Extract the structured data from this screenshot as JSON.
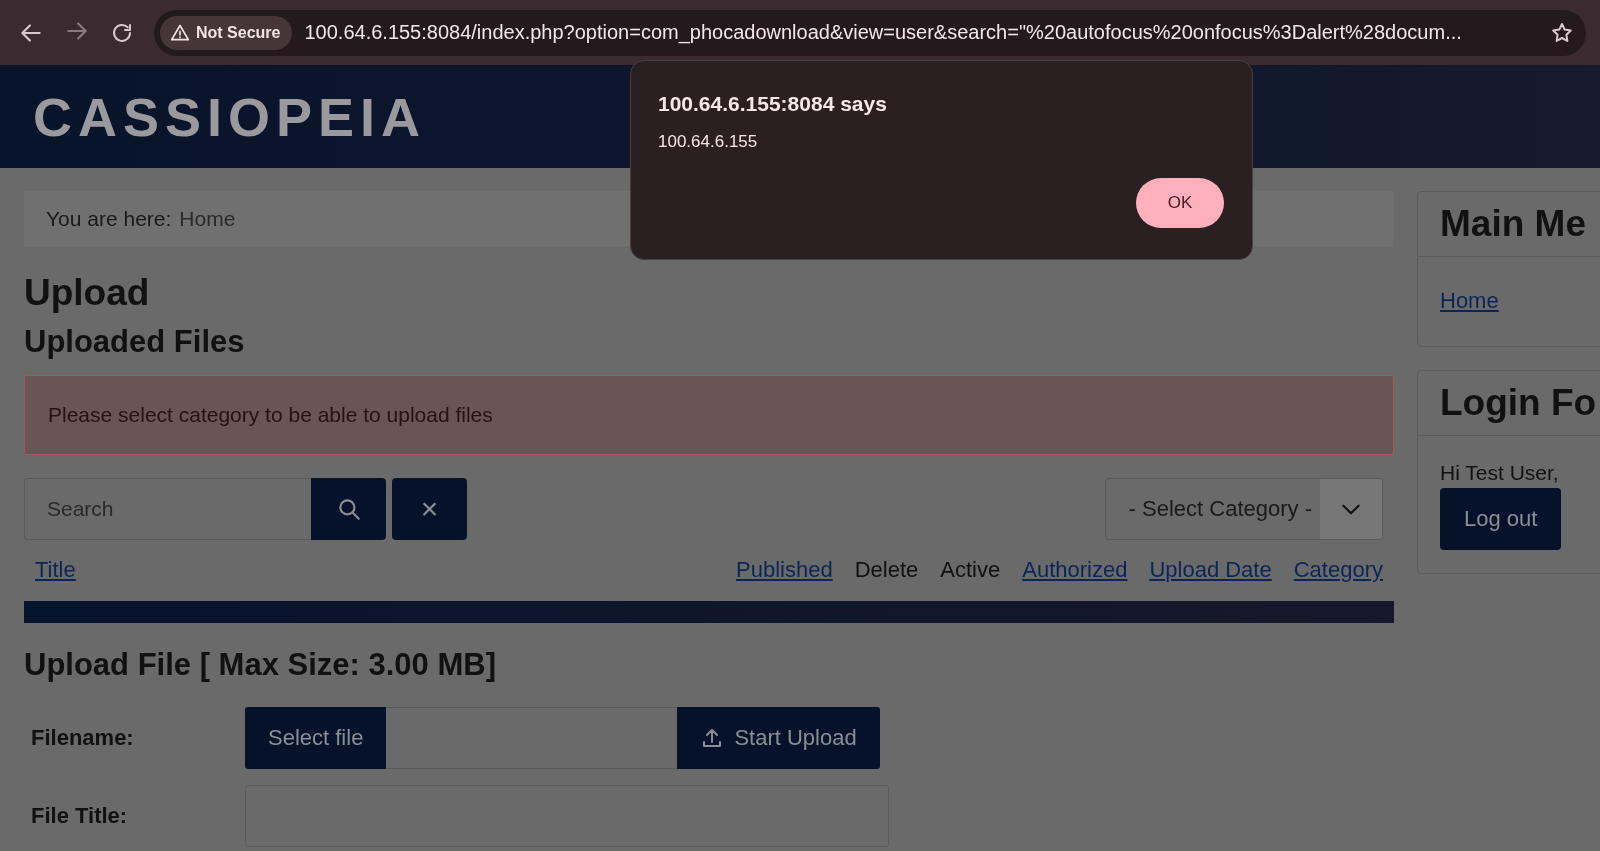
{
  "browser": {
    "security_label": "Not Secure",
    "url": "100.64.6.155:8084/index.php?option=com_phocadownload&view=user&search=\"%20autofocus%20onfocus%3Dalert%28docum..."
  },
  "site": {
    "logo": "CASSIOPEIA"
  },
  "breadcrumb": {
    "label": "You are here:",
    "items": [
      "Home"
    ]
  },
  "page_title": "Upload",
  "section_title": "Uploaded Files",
  "alert": "Please select category to be able to upload files",
  "filters": {
    "search_placeholder": "Search",
    "clear_label": "×",
    "category_select": "- Select Category -"
  },
  "table": {
    "columns": [
      {
        "label": "Title",
        "sortable": true
      },
      {
        "label": "Published",
        "sortable": true
      },
      {
        "label": "Delete",
        "sortable": false
      },
      {
        "label": "Active",
        "sortable": false
      },
      {
        "label": "Authorized",
        "sortable": true
      },
      {
        "label": "Upload Date",
        "sortable": true
      },
      {
        "label": "Category",
        "sortable": true
      }
    ]
  },
  "upload": {
    "title": "Upload File [ Max Size: 3.00 MB]",
    "filename_label": "Filename:",
    "select_button": "Select file",
    "start_button": "Start Upload",
    "file_title_label": "File Title:"
  },
  "sidebar": [
    {
      "kind": "menu",
      "title": "Main Me",
      "links": [
        "Home"
      ]
    },
    {
      "kind": "login",
      "title": "Login Fo",
      "greeting": "Hi Test User,",
      "button": "Log out"
    }
  ],
  "dialog": {
    "title": "100.64.6.155:8084 says",
    "message": "100.64.6.155",
    "button": "OK"
  }
}
